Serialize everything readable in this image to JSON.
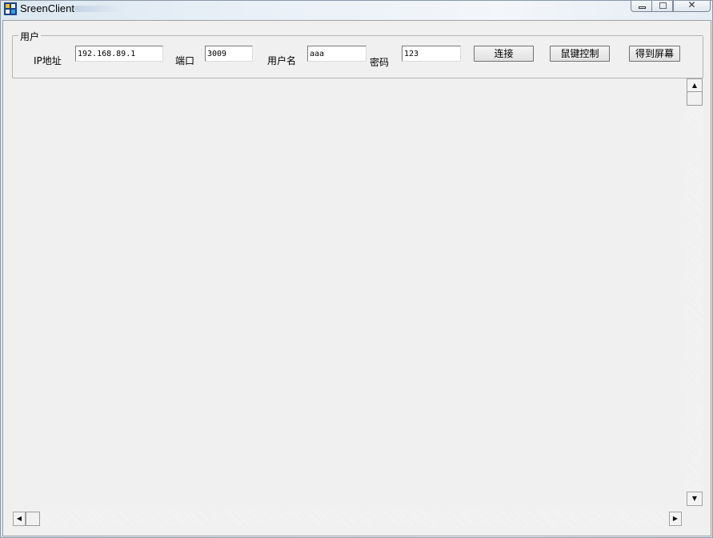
{
  "window": {
    "title": "SreenClient",
    "icon": "app-icon",
    "controls": [
      "minimize-icon",
      "maximize-icon",
      "close-icon"
    ]
  },
  "group": {
    "label": "用户"
  },
  "form": {
    "ip_label": "IP地址",
    "ip_value": "192.168.89.1",
    "port_label": "端口",
    "port_value": "3009",
    "user_label": "用户名",
    "user_value": "aaa",
    "password_label": "密码",
    "password_value": "123"
  },
  "buttons": {
    "connect": "连接",
    "mouse_keyboard_control": "鼠键控制",
    "get_screen": "得到屏幕"
  }
}
